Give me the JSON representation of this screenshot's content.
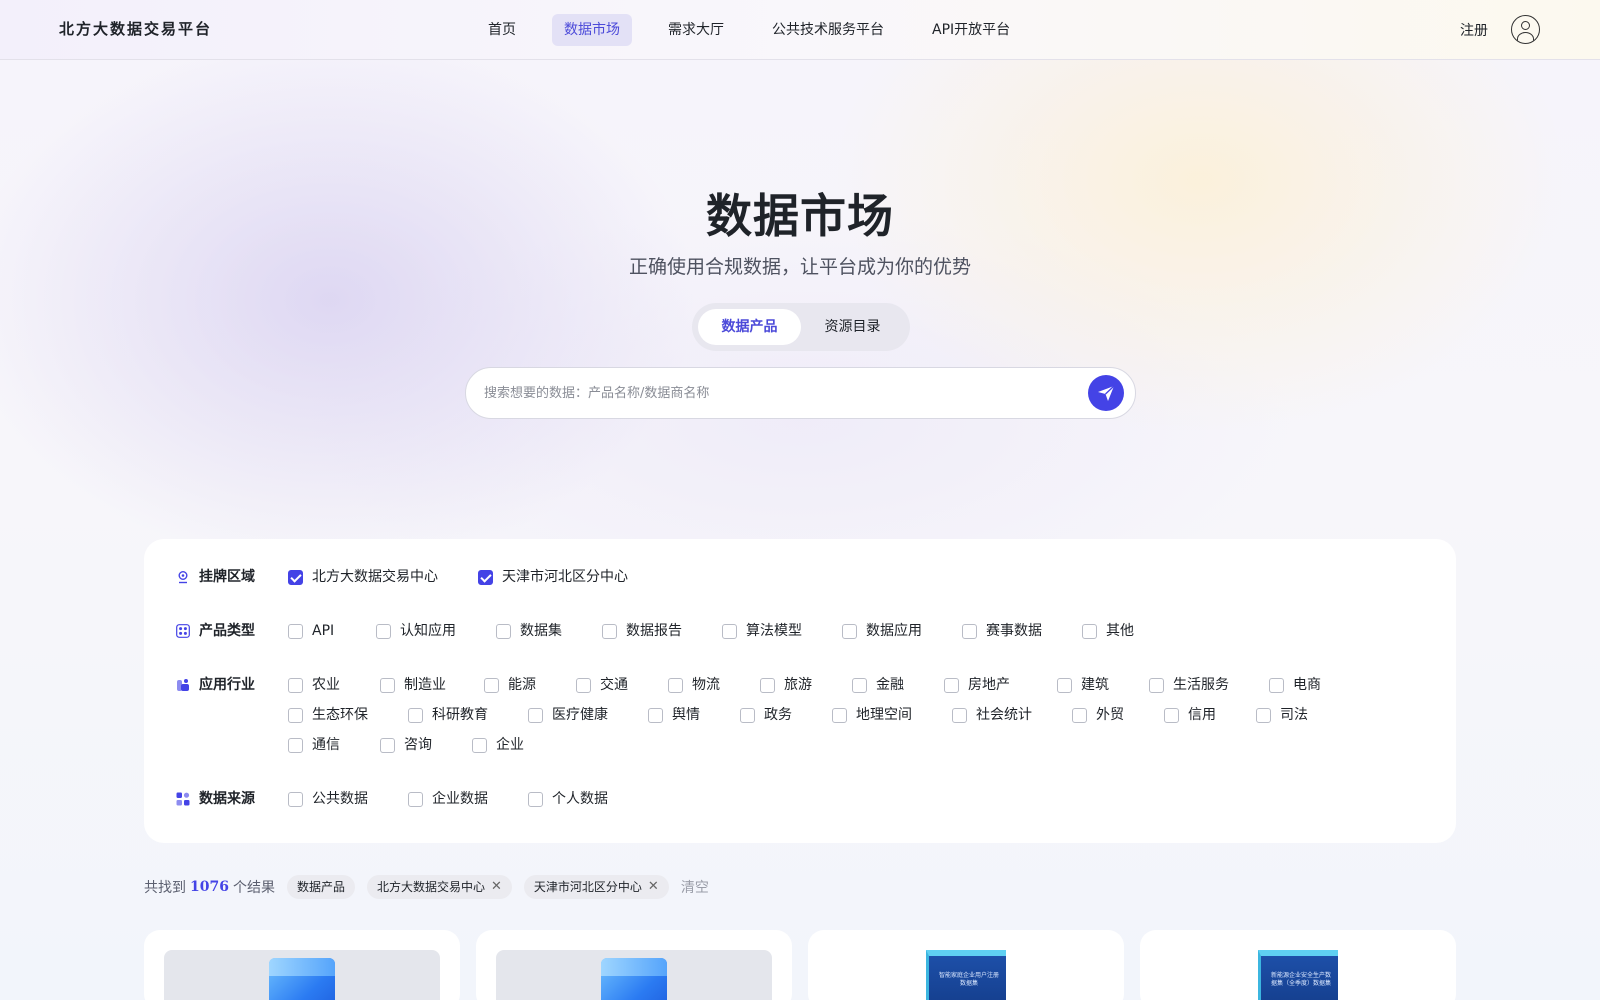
{
  "header": {
    "logo": "北方大数据交易平台",
    "nav": [
      "首页",
      "数据市场",
      "需求大厅",
      "公共技术服务平台",
      "API开放平台"
    ],
    "active_nav": "数据市场",
    "register": "注册"
  },
  "hero": {
    "title": "数据市场",
    "subtitle": "正确使用合规数据，让平台成为你的优势",
    "tabs": [
      "数据产品",
      "资源目录"
    ],
    "active_tab": "数据产品",
    "search_placeholder": "搜索想要的数据：产品名称/数据商名称"
  },
  "filters": {
    "region": {
      "label": "挂牌区域",
      "options": [
        {
          "label": "北方大数据交易中心",
          "checked": true
        },
        {
          "label": "天津市河北区分中心",
          "checked": true
        }
      ]
    },
    "product_type": {
      "label": "产品类型",
      "options": [
        "API",
        "认知应用",
        "数据集",
        "数据报告",
        "算法模型",
        "数据应用",
        "赛事数据",
        "其他"
      ]
    },
    "industry": {
      "label": "应用行业",
      "options": [
        "农业",
        "制造业",
        "能源",
        "交通",
        "物流",
        "旅游",
        "金融",
        "房地产",
        "建筑",
        "生活服务",
        "电商",
        "生态环保",
        "科研教育",
        "医疗健康",
        "舆情",
        "政务",
        "地理空间",
        "社会统计",
        "外贸",
        "信用",
        "司法",
        "通信",
        "咨询",
        "企业"
      ]
    },
    "source": {
      "label": "数据来源",
      "options": [
        "公共数据",
        "企业数据",
        "个人数据"
      ]
    }
  },
  "results": {
    "prefix": "共找到",
    "count": "1076",
    "suffix": "个结果",
    "tags": [
      "数据产品",
      "北方大数据交易中心",
      "天津市河北区分中心"
    ],
    "clear": "清空"
  },
  "cards": [
    {
      "thumb": "cube"
    },
    {
      "thumb": "cube"
    },
    {
      "thumb": "book",
      "cover_text": "智能家庭企业用户注册数据集"
    },
    {
      "thumb": "book",
      "cover_text": "新能源企业安全生产数据集（全季度）数据集"
    }
  ],
  "colors": {
    "accent": "#4443e6",
    "nav_active_bg": "#e3e1f6"
  }
}
